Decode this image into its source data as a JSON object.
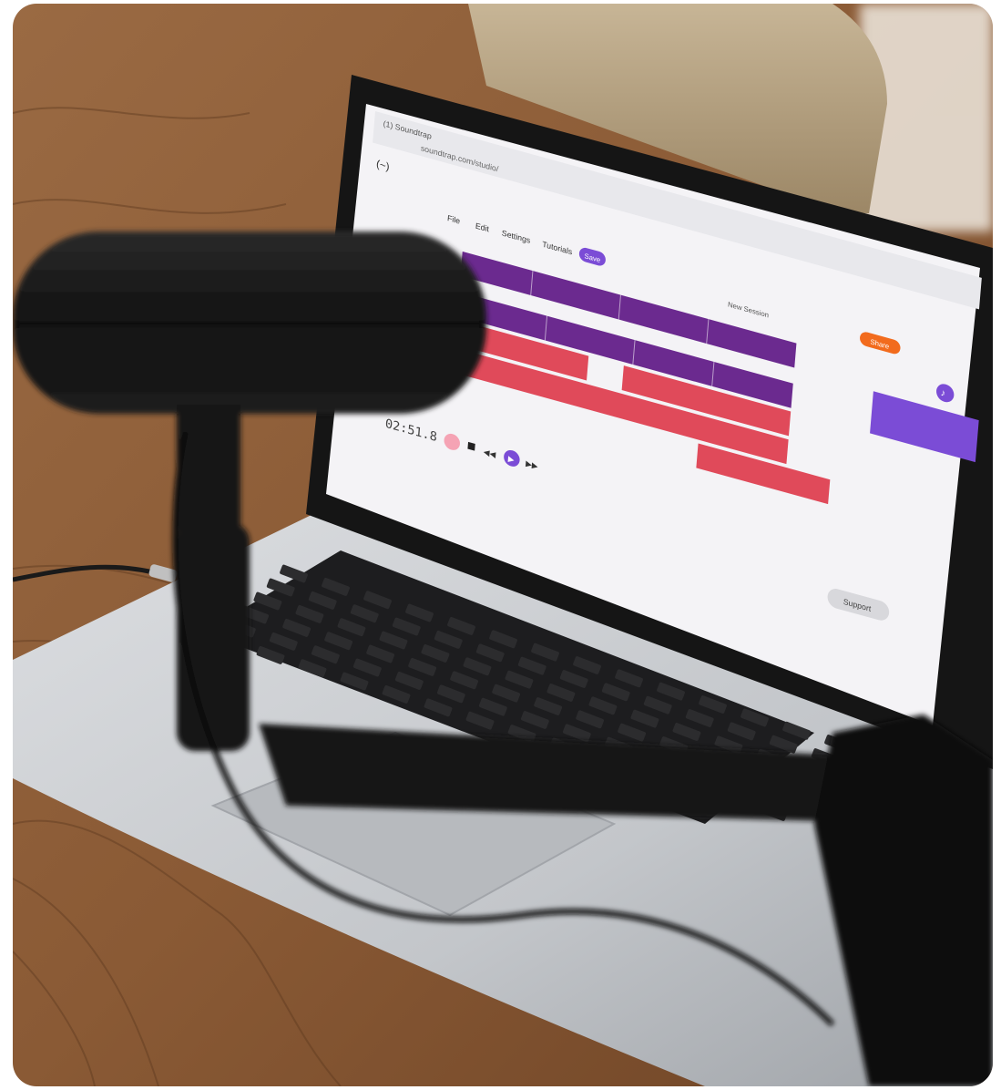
{
  "photo": {
    "subject": "laptop-with-microphone",
    "colors": {
      "wood": "#8a5a35",
      "wood_dark": "#5e3a20",
      "laptop_silver": "#c9cbce",
      "screen_bg": "#f4f3f6",
      "track_purple": "#6b2a8f",
      "track_red": "#e04a5a",
      "accent_orange": "#f26b1d",
      "accent_violet": "#7b4cd6",
      "mic_black": "#141414"
    }
  },
  "screen": {
    "browser_tab": "(1) Soundtrap",
    "address": "soundtrap.com/studio/",
    "app_logo": "(~)",
    "menu": {
      "file": "File",
      "edit": "Edit",
      "settings": "Settings",
      "tutorials": "Tutorials"
    },
    "save_label": "Save",
    "session_title": "New Session",
    "share_label": "Share",
    "time_display": "02:51.8",
    "support_label": "Support"
  }
}
